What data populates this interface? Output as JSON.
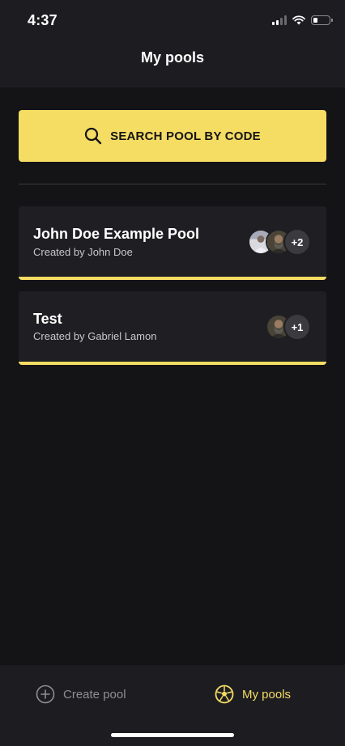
{
  "status_bar": {
    "time": "4:37"
  },
  "header": {
    "title": "My pools"
  },
  "search": {
    "label": "SEARCH POOL BY CODE",
    "icon": "search-icon"
  },
  "pools": [
    {
      "name": "John Doe Example Pool",
      "creator": "Created by John Doe",
      "extra_members": "+2"
    },
    {
      "name": "Test",
      "creator": "Created by Gabriel Lamon",
      "extra_members": "+1"
    }
  ],
  "nav": {
    "create_label": "Create pool",
    "pools_label": "My pools",
    "active": "My pools"
  },
  "colors": {
    "accent": "#f5dc63",
    "background": "#141416",
    "card": "#1f1f23",
    "header": "#1d1d21"
  }
}
